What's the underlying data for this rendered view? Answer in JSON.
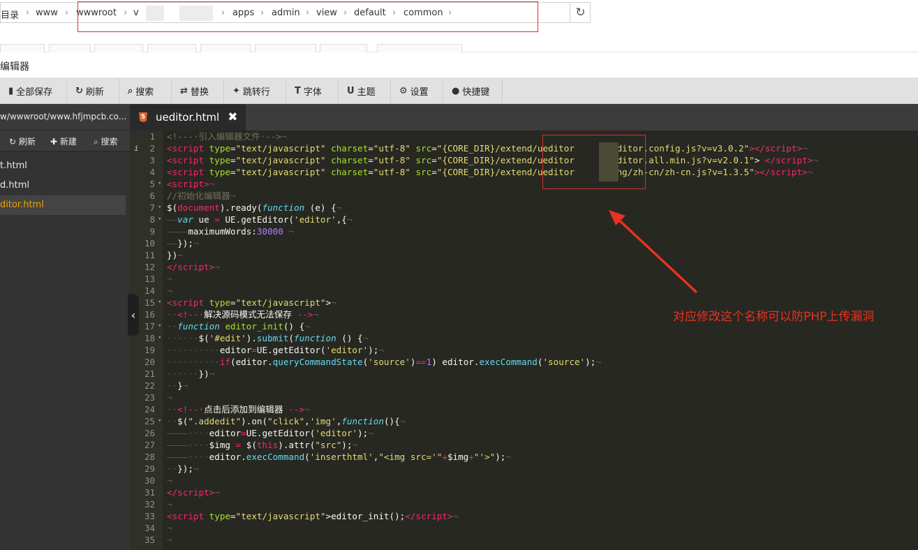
{
  "breadcrumb": {
    "items": [
      "目录",
      "www",
      "wwwroot",
      "v",
      "apps",
      "admin",
      "view",
      "default",
      "common"
    ],
    "refresh_icon": "refresh-icon"
  },
  "window": {
    "title": "编辑器"
  },
  "toolbar": {
    "items": [
      {
        "icon": "save-icon",
        "label": "全部保存"
      },
      {
        "icon": "refresh-icon",
        "label": "刷新"
      },
      {
        "icon": "search-icon",
        "label": "搜索"
      },
      {
        "icon": "replace-icon",
        "label": "替换"
      },
      {
        "icon": "pin-icon",
        "label": "跳转行"
      },
      {
        "icon": "font-icon",
        "label": "字体"
      },
      {
        "icon": "magnet-icon",
        "label": "主题"
      },
      {
        "icon": "gear-icon",
        "label": "设置"
      },
      {
        "icon": "info-icon",
        "label": "快捷键"
      }
    ]
  },
  "sidebar": {
    "path": "w/wwwroot/www.hfjmpcb.co...",
    "actions": [
      {
        "icon": "refresh-icon",
        "label": "刷新"
      },
      {
        "icon": "plus-icon",
        "label": "新建"
      },
      {
        "icon": "search-icon",
        "label": "搜索"
      }
    ],
    "files": [
      {
        "label": "t.html",
        "active": false
      },
      {
        "label": "d.html",
        "active": false
      },
      {
        "label": "ditor.html",
        "active": true
      }
    ]
  },
  "editor_tab": {
    "label": "ueditor.html",
    "close": "✖"
  },
  "editor": {
    "line_numbers": [
      "1",
      "2",
      "3",
      "4",
      "5",
      "6",
      "7",
      "8",
      "9",
      "10",
      "11",
      "12",
      "13",
      "14",
      "15",
      "16",
      "17",
      "18",
      "19",
      "20",
      "21",
      "22",
      "23",
      "24",
      "25",
      "26",
      "27",
      "28",
      "29",
      "30",
      "31",
      "32",
      "33",
      "34",
      "35"
    ]
  },
  "annotation": {
    "text": "对应修改这个名称可以防PHP上传漏洞",
    "color": "#e8321f"
  },
  "colors": {
    "editor_bg": "#272822",
    "sidebar_bg": "#333333",
    "toolbar_bg": "#e1e1e1",
    "highlight_box": "#d9302c",
    "active_file": "#f0a000"
  }
}
